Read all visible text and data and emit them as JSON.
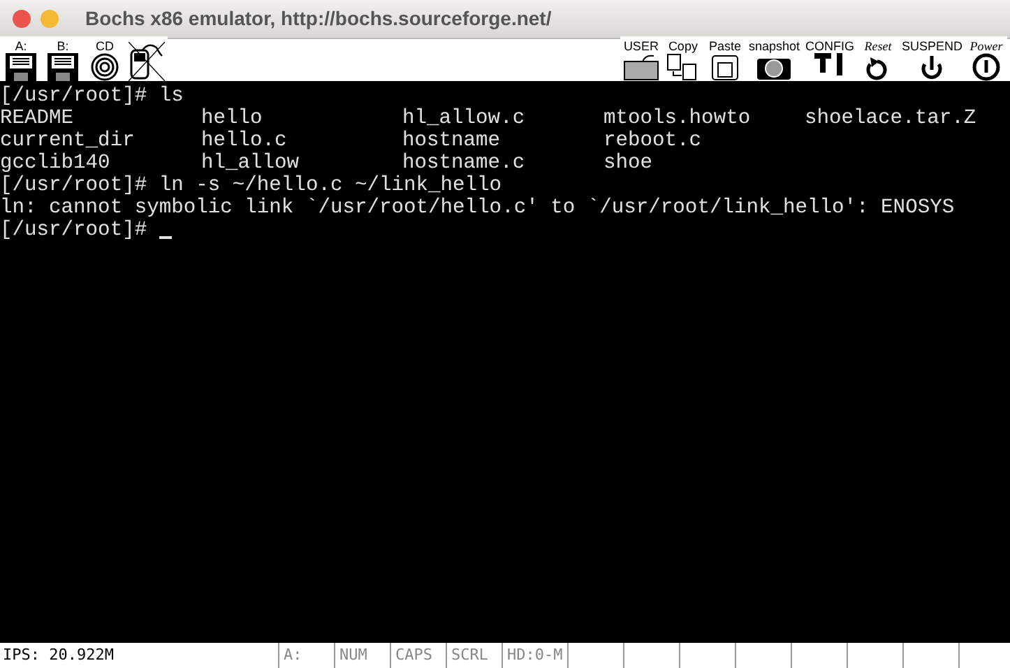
{
  "window": {
    "title": "Bochs x86 emulator, http://bochs.sourceforge.net/"
  },
  "toolbar_left": [
    {
      "kind": "floppy",
      "label": "A:"
    },
    {
      "kind": "floppy",
      "label": "B:"
    },
    {
      "kind": "cdrom",
      "label": "CD"
    },
    {
      "kind": "mouse"
    }
  ],
  "toolbar_right": [
    {
      "kind": "keyboard",
      "label": "USER"
    },
    {
      "kind": "copy",
      "label": "Copy"
    },
    {
      "kind": "paste",
      "label": "Paste"
    },
    {
      "kind": "camera",
      "label": "snapshot"
    },
    {
      "kind": "config",
      "label": "CONFIG"
    },
    {
      "kind": "reset",
      "label": "Reset"
    },
    {
      "kind": "suspend",
      "label": "SUSPEND"
    },
    {
      "kind": "power",
      "label": "Power"
    }
  ],
  "terminal": {
    "lines": [
      {
        "kind": "text",
        "text": "[/usr/root]# ls"
      },
      {
        "kind": "columns",
        "cells": [
          "README",
          "hello",
          "hl_allow.c",
          "mtools.howto",
          "shoelace.tar.Z"
        ]
      },
      {
        "kind": "columns",
        "cells": [
          "current_dir",
          "hello.c",
          "hostname",
          "reboot.c"
        ]
      },
      {
        "kind": "columns",
        "cells": [
          "gcclib140",
          "hl_allow",
          "hostname.c",
          "shoe"
        ]
      },
      {
        "kind": "text",
        "text": "[/usr/root]# ln -s ~/hello.c ~/link_hello"
      },
      {
        "kind": "text",
        "text": "ln: cannot symbolic link `/usr/root/hello.c' to `/usr/root/link_hello': ENOSYS"
      },
      {
        "kind": "prompt",
        "text": "[/usr/root]# "
      }
    ]
  },
  "status_bar": {
    "ips": "IPS: 20.922M",
    "indicators": [
      {
        "label": "A:",
        "active": false
      },
      {
        "label": "NUM",
        "active": false
      },
      {
        "label": "CAPS",
        "active": false
      },
      {
        "label": "SCRL",
        "active": false
      },
      {
        "label": "HD:0-M",
        "active": false
      }
    ]
  }
}
